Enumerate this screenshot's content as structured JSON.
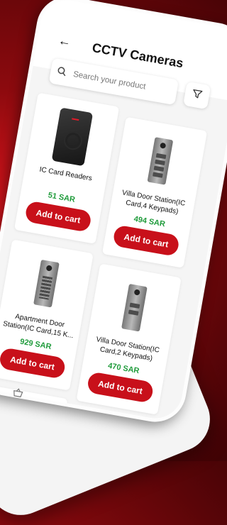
{
  "screen": {
    "title": "CCTV Cameras",
    "back_icon": "back-arrow-icon",
    "search": {
      "placeholder": "Search your product",
      "value": ""
    },
    "filter_icon": "filter-icon"
  },
  "colors": {
    "accent": "#c8101a",
    "price": "#1f9b3b",
    "background": "#8c0a0e"
  },
  "products": [
    {
      "name": "IC Card Readers",
      "price": "51 SAR",
      "button": "Add to cart"
    },
    {
      "name": "Villa Door Station(IC Card,4 Keypads)",
      "price": "494 SAR",
      "button": "Add to cart"
    },
    {
      "name": "Apartment Door Station(IC Card,15 K...",
      "price": "929 SAR",
      "button": "Add to cart"
    },
    {
      "name": "Villa Door Station(IC Card,2 Keypads)",
      "price": "470 SAR",
      "button": "Add to cart"
    }
  ],
  "nav": {
    "cart_icon": "basket-icon"
  }
}
